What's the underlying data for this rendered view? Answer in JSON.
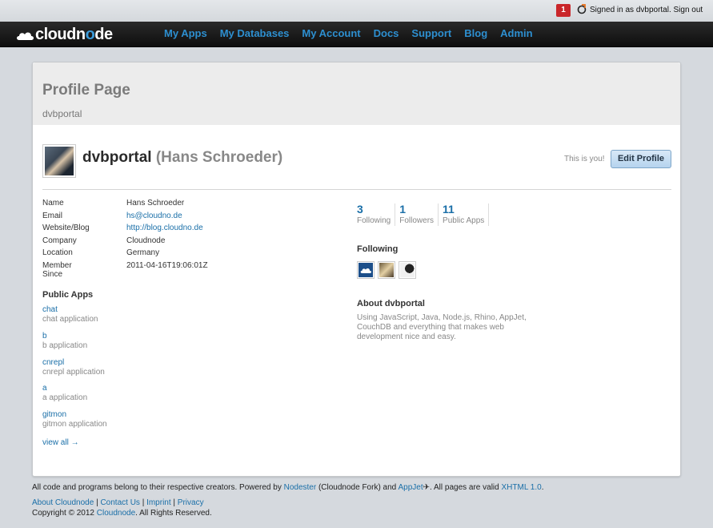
{
  "topbar": {
    "notification_count": "1",
    "signed_in_text": "Signed in as dvbportal.",
    "sign_out_label": "Sign out"
  },
  "nav": {
    "logo_text_a": "cloud",
    "logo_text_b": "n",
    "logo_text_c": "o",
    "logo_text_d": "de",
    "items": [
      "My Apps",
      "My Databases",
      "My Account",
      "Docs",
      "Support",
      "Blog",
      "Admin"
    ]
  },
  "header": {
    "title": "Profile Page",
    "subtitle": "dvbportal"
  },
  "profile": {
    "username": "dvbportal",
    "realname": "(Hans Schroeder)",
    "this_is_you": "This is you!",
    "edit_label": "Edit Profile",
    "fields": [
      {
        "label": "Name",
        "value": "Hans Schroeder"
      },
      {
        "label": "Email",
        "value": "hs@cloudno.de"
      },
      {
        "label": "Website/Blog",
        "value": "http://blog.cloudno.de"
      },
      {
        "label": "Company",
        "value": "Cloudnode"
      },
      {
        "label": "Location",
        "value": "Germany"
      },
      {
        "label": "Member Since",
        "value": "2011-04-16T19:06:01Z"
      }
    ]
  },
  "public_apps": {
    "title": "Public Apps",
    "apps": [
      {
        "name": "chat",
        "desc": "chat application"
      },
      {
        "name": "b",
        "desc": "b application"
      },
      {
        "name": "cnrepl",
        "desc": "cnrepl application"
      },
      {
        "name": "a",
        "desc": "a application"
      },
      {
        "name": "gitmon",
        "desc": "gitmon application"
      }
    ],
    "view_all": "view all →"
  },
  "stats": [
    {
      "num": "3",
      "label": "Following"
    },
    {
      "num": "1",
      "label": "Followers"
    },
    {
      "num": "11",
      "label": "Public Apps"
    }
  ],
  "following": {
    "title": "Following"
  },
  "about": {
    "title": "About dvbportal",
    "text": "Using JavaScript, Java, Node.js, Rhino, AppJet, CouchDB and everything that makes web development nice and easy."
  },
  "footer": {
    "line1_a": "All code and programs belong to their respective creators. Powered by ",
    "nodester": "Nodester",
    "line1_b": " (Cloudnode Fork) and ",
    "appjet": "AppJet",
    "line1_c": "✈. All pages are valid ",
    "xhtml": "XHTML 1.0",
    "line1_d": ".",
    "about": "About Cloudnode",
    "contact": "Contact Us",
    "imprint": "Imprint",
    "privacy": "Privacy",
    "sep": " | ",
    "copyright_a": "Copyright © 2012 ",
    "cloudnode": "Cloudnode",
    "copyright_b": ". All Rights Reserved."
  }
}
